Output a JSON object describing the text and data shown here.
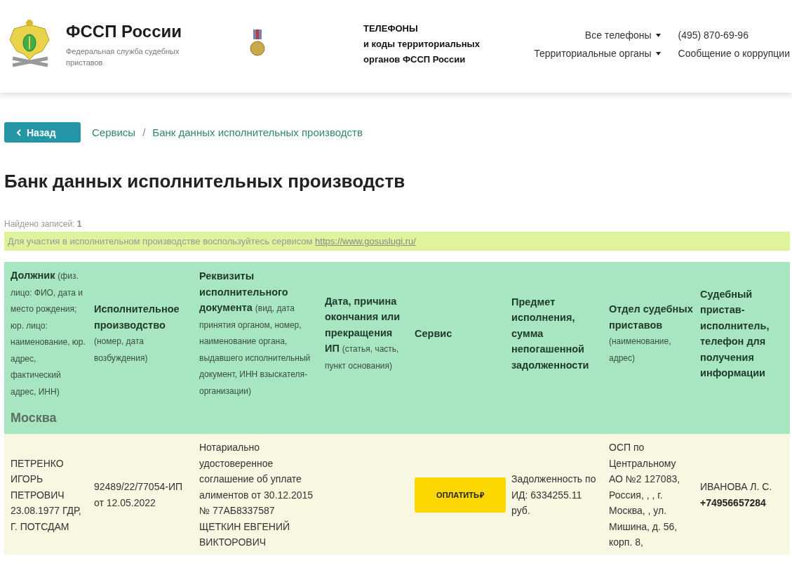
{
  "header": {
    "title": "ФССП России",
    "subtitle": "Федеральная служба судебных приставов",
    "phones_block": [
      "ТЕЛЕФОНЫ",
      "и коды территориальных",
      "органов ФССП России"
    ],
    "nav": [
      {
        "label": "Все телефоны",
        "dropdown": true
      },
      {
        "label": "Территориальные органы",
        "dropdown": true
      }
    ],
    "contacts": [
      "(495) 870-69-96",
      "Сообщение о коррупции"
    ]
  },
  "back_button": "Назад",
  "breadcrumbs": [
    "Сервисы",
    "Банк данных исполнительных производств"
  ],
  "breadcrumb_separator": "/",
  "page_title": "Банк данных исполнительных производств",
  "found": {
    "label": "Найдено записей:",
    "count": "1"
  },
  "notice": {
    "text": "Для участия в исполнительном производстве воспользуйтесь сервисом",
    "link": "https://www.gosuslugi.ru/"
  },
  "table": {
    "columns": [
      {
        "title": "Должник",
        "note": "(физ. лицо: ФИО, дата и место рождения; юр. лицо: наименование, юр. адрес, фактический адрес, ИНН)"
      },
      {
        "title": "Исполнительное производство",
        "note": "(номер, дата возбуждения)"
      },
      {
        "title": "Реквизиты исполнительного документа",
        "note": "(вид, дата принятия органом, номер, наименование органа, выдавшего исполнительный документ, ИНН взыскателя-организации)"
      },
      {
        "title": "Дата, причина окончания или прекращения ИП",
        "note": "(статья, часть, пункт основания)"
      },
      {
        "title": "Сервис"
      },
      {
        "title": "Предмет исполнения, сумма непогашенной задолженности"
      },
      {
        "title": "Отдел судебных приставов",
        "note": "(наименование, адрес)"
      },
      {
        "title": "Судебный пристав-исполнитель, телефон для получения информации"
      }
    ],
    "region": "Москва",
    "rows": [
      {
        "debtor": "ПЕТРЕНКО ИГОРЬ ПЕТРОВИЧ 23.08.1977 ГДР, Г. ПОТСДАМ",
        "proceeding": "92489/22/77054-ИП от 12.05.2022",
        "document": "Нотариально удостоверенное соглашение об уплате алиментов от 30.12.2015 № 77АБ8337587 ЩЕТКИН ЕВГЕНИЙ ВИКТОРОВИЧ",
        "pay_button": "ОПЛАТИТЬ",
        "currency": "₽",
        "subject": "Задолженность по ИД: 6334255.11 руб.",
        "department": "ОСП по Центральному АО №2 127083, Россия, , , г. Москва, , ул. Мишина, д. 56, корп. 8,",
        "bailiff": "ИВАНОВА Л. С.",
        "phone": "+74956657284"
      }
    ]
  }
}
